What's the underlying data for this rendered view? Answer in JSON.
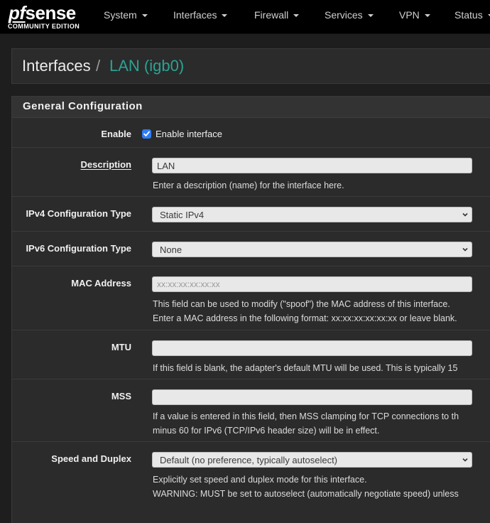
{
  "brand": {
    "logo_pf": "pf",
    "logo_sense": "sense",
    "edition": "COMMUNITY EDITION"
  },
  "nav": {
    "items": [
      {
        "label": "System"
      },
      {
        "label": "Interfaces"
      },
      {
        "label": "Firewall"
      },
      {
        "label": "Services"
      },
      {
        "label": "VPN"
      },
      {
        "label": "Status"
      }
    ]
  },
  "breadcrumb": {
    "root": "Interfaces",
    "separator": "/",
    "current": "LAN (igb0)"
  },
  "panel": {
    "title": "General Configuration"
  },
  "form": {
    "enable": {
      "label": "Enable",
      "checkbox_label": "Enable interface",
      "checked": true
    },
    "description": {
      "label": "Description",
      "value": "LAN",
      "help": "Enter a description (name) for the interface here."
    },
    "ipv4_type": {
      "label": "IPv4 Configuration Type",
      "value": "Static IPv4"
    },
    "ipv6_type": {
      "label": "IPv6 Configuration Type",
      "value": "None"
    },
    "mac": {
      "label": "MAC Address",
      "placeholder": "xx:xx:xx:xx:xx:xx",
      "help1": "This field can be used to modify (\"spoof\") the MAC address of this interface.",
      "help2": "Enter a MAC address in the following format: xx:xx:xx:xx:xx:xx or leave blank."
    },
    "mtu": {
      "label": "MTU",
      "value": "",
      "help": "If this field is blank, the adapter's default MTU will be used. This is typically 15"
    },
    "mss": {
      "label": "MSS",
      "value": "",
      "help1": "If a value is entered in this field, then MSS clamping for TCP connections to th",
      "help2": "minus 60 for IPv6 (TCP/IPv6 header size) will be in effect."
    },
    "speed": {
      "label": "Speed and Duplex",
      "value": "Default (no preference, typically autoselect)",
      "help1": "Explicitly set speed and duplex mode for this interface.",
      "help2": "WARNING: MUST be set to autoselect (automatically negotiate speed) unless"
    }
  },
  "colors": {
    "accent": "#2aa394",
    "navbar": "#000000",
    "panel": "#2b2b2b",
    "checkbox": "#2f7df6"
  }
}
